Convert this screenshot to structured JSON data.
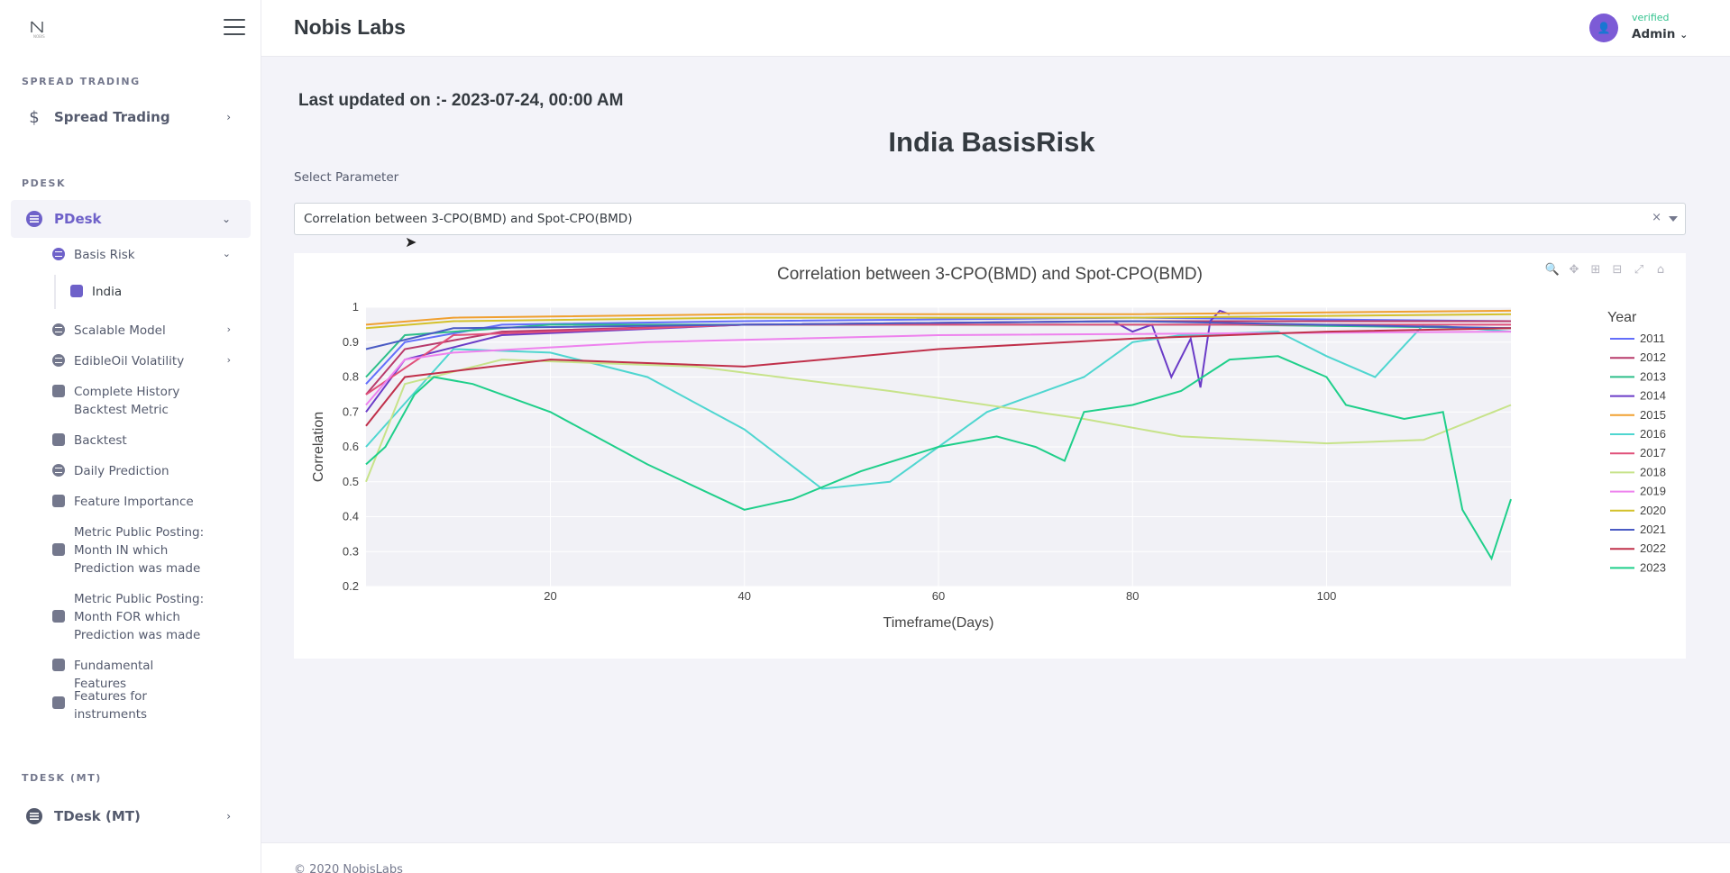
{
  "brand": "Nobis Labs",
  "header": {
    "status": "verified",
    "user": "Admin"
  },
  "sidebar": {
    "sections": [
      {
        "title": "SPREAD TRADING",
        "item": "Spread Trading"
      },
      {
        "title": "PDESK",
        "item": "PDesk"
      },
      {
        "title": "TDESK (MT)",
        "item": "TDesk (MT)"
      }
    ],
    "pdesk_items": [
      "Basis Risk",
      "India",
      "Scalable Model",
      "EdibleOil Volatility",
      "Complete History Backtest Metric",
      "Backtest",
      "Daily Prediction",
      "Feature Importance",
      "Metric Public Posting: Month IN which Prediction was made",
      "Metric Public Posting: Month FOR which Prediction was made",
      "Fundamental Features",
      "Features for instruments"
    ]
  },
  "main": {
    "last_updated": "Last updated on :- 2023-07-24, 00:00 AM",
    "title": "India BasisRisk",
    "select_label": "Select Parameter",
    "select_value": "Correlation between 3-CPO(BMD) and Spot-CPO(BMD)",
    "clear_symbol": "×"
  },
  "footer": "© 2020 NobisLabs",
  "icons": [
    "dollar-icon",
    "pdesk-icon",
    "tdesk-icon",
    "chevron-right-icon",
    "chevron-down-icon",
    "hamburger-icon",
    "user-icon",
    "zoom-icon",
    "pan-icon",
    "zoom-in-icon",
    "zoom-out-icon",
    "autoscale-icon",
    "home-icon"
  ],
  "colors": {
    "accent": "#6e61c9",
    "verified": "#34c38f"
  },
  "chart_data": {
    "type": "line",
    "title": "Correlation between 3-CPO(BMD) and Spot-CPO(BMD)",
    "xlabel": "Timeframe(Days)",
    "ylabel": "Correlation",
    "xlim": [
      1,
      119
    ],
    "ylim": [
      0.2,
      1.0
    ],
    "x_ticks": [
      20,
      40,
      60,
      80,
      100
    ],
    "y_ticks": [
      0.2,
      0.3,
      0.4,
      0.5,
      0.6,
      0.7,
      0.8,
      0.9,
      1
    ],
    "legend_title": "Year",
    "legend_position": "right",
    "series": [
      {
        "name": "2011",
        "color": "#636efa",
        "points": [
          [
            1,
            0.78
          ],
          [
            5,
            0.9
          ],
          [
            15,
            0.95
          ],
          [
            40,
            0.96
          ],
          [
            80,
            0.97
          ],
          [
            119,
            0.96
          ]
        ]
      },
      {
        "name": "2012",
        "color": "#b83a6b",
        "points": [
          [
            1,
            0.75
          ],
          [
            5,
            0.88
          ],
          [
            15,
            0.93
          ],
          [
            40,
            0.95
          ],
          [
            80,
            0.96
          ],
          [
            119,
            0.96
          ]
        ]
      },
      {
        "name": "2013",
        "color": "#2dbf8a",
        "points": [
          [
            1,
            0.8
          ],
          [
            5,
            0.92
          ],
          [
            20,
            0.95
          ],
          [
            60,
            0.95
          ],
          [
            90,
            0.95
          ],
          [
            119,
            0.94
          ]
        ]
      },
      {
        "name": "2014",
        "color": "#6a3bc7",
        "points": [
          [
            1,
            0.7
          ],
          [
            5,
            0.85
          ],
          [
            15,
            0.92
          ],
          [
            40,
            0.95
          ],
          [
            78,
            0.96
          ],
          [
            80,
            0.93
          ],
          [
            82,
            0.95
          ],
          [
            84,
            0.8
          ],
          [
            86,
            0.91
          ],
          [
            87,
            0.77
          ],
          [
            88,
            0.96
          ],
          [
            89,
            0.99
          ],
          [
            90,
            0.98
          ]
        ]
      },
      {
        "name": "2015",
        "color": "#f0a030",
        "points": [
          [
            1,
            0.95
          ],
          [
            10,
            0.97
          ],
          [
            40,
            0.98
          ],
          [
            80,
            0.98
          ],
          [
            119,
            0.99
          ]
        ]
      },
      {
        "name": "2016",
        "color": "#4fd6d0",
        "points": [
          [
            1,
            0.6
          ],
          [
            10,
            0.88
          ],
          [
            20,
            0.87
          ],
          [
            30,
            0.8
          ],
          [
            40,
            0.65
          ],
          [
            48,
            0.48
          ],
          [
            55,
            0.5
          ],
          [
            65,
            0.7
          ],
          [
            75,
            0.8
          ],
          [
            80,
            0.9
          ],
          [
            85,
            0.92
          ],
          [
            95,
            0.93
          ],
          [
            100,
            0.86
          ],
          [
            105,
            0.8
          ],
          [
            110,
            0.95
          ],
          [
            119,
            0.93
          ]
        ]
      },
      {
        "name": "2017",
        "color": "#e0507a",
        "points": [
          [
            1,
            0.75
          ],
          [
            10,
            0.92
          ],
          [
            40,
            0.95
          ],
          [
            80,
            0.95
          ],
          [
            119,
            0.95
          ]
        ]
      },
      {
        "name": "2018",
        "color": "#c7e38a",
        "points": [
          [
            1,
            0.5
          ],
          [
            5,
            0.78
          ],
          [
            15,
            0.85
          ],
          [
            35,
            0.83
          ],
          [
            55,
            0.76
          ],
          [
            75,
            0.68
          ],
          [
            85,
            0.63
          ],
          [
            100,
            0.61
          ],
          [
            110,
            0.62
          ],
          [
            119,
            0.72
          ]
        ]
      },
      {
        "name": "2019",
        "color": "#ee82ee",
        "points": [
          [
            1,
            0.72
          ],
          [
            5,
            0.85
          ],
          [
            10,
            0.87
          ],
          [
            30,
            0.9
          ],
          [
            60,
            0.92
          ],
          [
            119,
            0.93
          ]
        ]
      },
      {
        "name": "2020",
        "color": "#d4c12a",
        "points": [
          [
            1,
            0.94
          ],
          [
            10,
            0.96
          ],
          [
            40,
            0.97
          ],
          [
            80,
            0.97
          ],
          [
            119,
            0.98
          ]
        ]
      },
      {
        "name": "2021",
        "color": "#4a5bc4",
        "points": [
          [
            1,
            0.88
          ],
          [
            10,
            0.94
          ],
          [
            40,
            0.95
          ],
          [
            80,
            0.96
          ],
          [
            119,
            0.94
          ]
        ]
      },
      {
        "name": "2022",
        "color": "#c0304a",
        "points": [
          [
            1,
            0.66
          ],
          [
            5,
            0.8
          ],
          [
            20,
            0.85
          ],
          [
            40,
            0.83
          ],
          [
            60,
            0.88
          ],
          [
            80,
            0.91
          ],
          [
            100,
            0.93
          ],
          [
            119,
            0.94
          ]
        ]
      },
      {
        "name": "2023",
        "color": "#1fcf8a",
        "points": [
          [
            1,
            0.55
          ],
          [
            3,
            0.6
          ],
          [
            6,
            0.75
          ],
          [
            8,
            0.8
          ],
          [
            12,
            0.78
          ],
          [
            20,
            0.7
          ],
          [
            30,
            0.55
          ],
          [
            40,
            0.42
          ],
          [
            45,
            0.45
          ],
          [
            52,
            0.53
          ],
          [
            60,
            0.6
          ],
          [
            66,
            0.63
          ],
          [
            70,
            0.6
          ],
          [
            73,
            0.56
          ],
          [
            75,
            0.7
          ],
          [
            80,
            0.72
          ],
          [
            85,
            0.76
          ],
          [
            90,
            0.85
          ],
          [
            95,
            0.86
          ],
          [
            100,
            0.8
          ],
          [
            102,
            0.72
          ],
          [
            108,
            0.68
          ],
          [
            112,
            0.7
          ],
          [
            114,
            0.42
          ],
          [
            117,
            0.28
          ],
          [
            119,
            0.45
          ]
        ]
      }
    ]
  }
}
